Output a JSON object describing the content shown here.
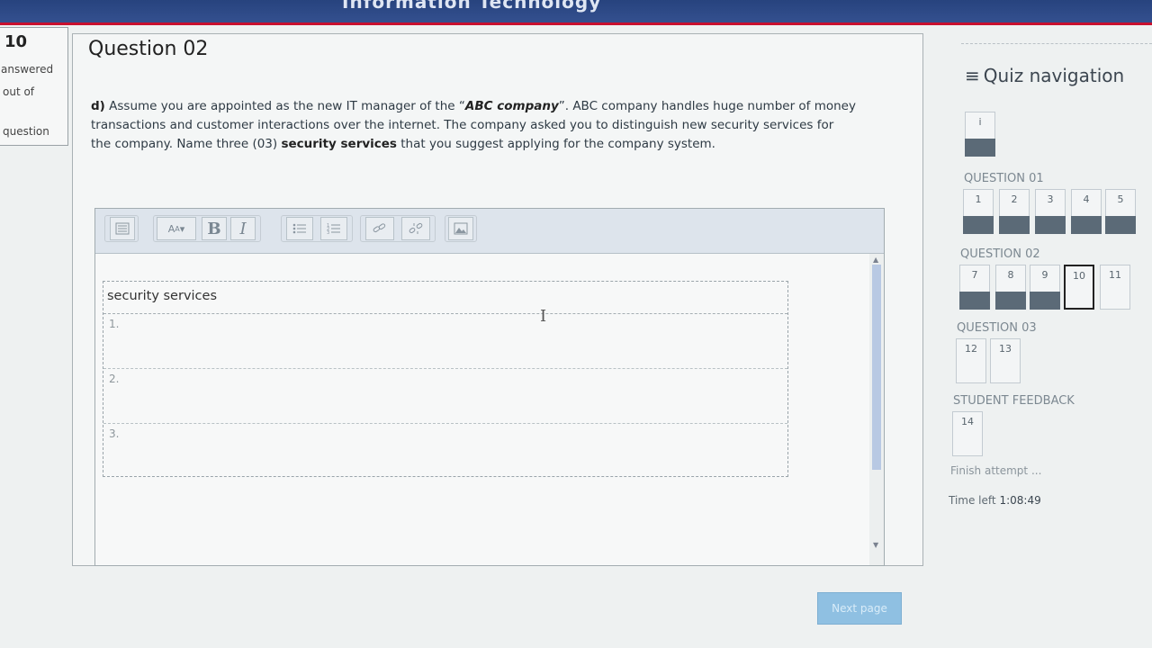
{
  "header": {
    "title": "Information Technology"
  },
  "info": {
    "qno": "10",
    "status1": "answered",
    "status2": "out of",
    "status3": "question"
  },
  "question": {
    "title": "Question 02",
    "label": "d)",
    "text_1": "Assume you are appointed as the new IT manager of the “",
    "company": "ABC company",
    "text_2": "”. ABC company handles huge number of money transactions and customer interactions over the internet. The company asked you to distinguish new security services for the company. Name three (03) ",
    "bold_term": "security services",
    "text_3": " that you suggest applying for the company system."
  },
  "editor": {
    "toolbar": {
      "toggle_icon": "toolbar-toggle-icon",
      "font_size_icon": "font-size-icon",
      "bold": "B",
      "italic": "I",
      "ul_icon": "unordered-list-icon",
      "ol_icon": "ordered-list-icon",
      "link_icon": "link-icon",
      "unlink_icon": "unlink-icon",
      "image_icon": "image-icon"
    },
    "table_header": "security services",
    "rows": [
      "1.",
      "2.",
      "3."
    ]
  },
  "next_button": "Next page",
  "nav": {
    "title": "Quiz navigation",
    "info_label": "i",
    "sections": [
      {
        "name": "QUESTION 01",
        "buttons": [
          "1",
          "2",
          "3",
          "4",
          "5"
        ]
      },
      {
        "name": "QUESTION 02",
        "buttons": [
          "7",
          "8",
          "9",
          "10",
          "11"
        ]
      },
      {
        "name": "QUESTION 03",
        "buttons": [
          "12",
          "13"
        ]
      },
      {
        "name": "STUDENT FEEDBACK",
        "buttons": [
          "14"
        ]
      }
    ],
    "current": "10",
    "finish": "Finish attempt ...",
    "time_label": "Time left",
    "time_value": "1:08:49"
  },
  "colors": {
    "accent": "#c8102e",
    "header_blue": "#27437e",
    "answered": "#5b6a77",
    "button": "#8fc0e2"
  }
}
